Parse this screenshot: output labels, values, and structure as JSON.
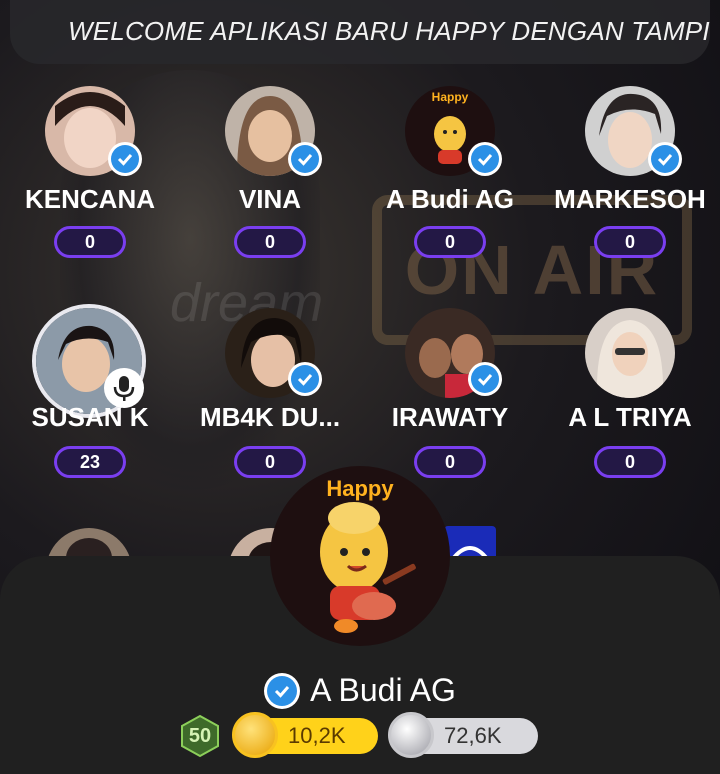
{
  "banner": {
    "text": "WELCOME APLIKASI BARU HAPPY DENGAN TAMPILAN BARU"
  },
  "background": {
    "onair_text": "ON AIR",
    "watermark": "dream"
  },
  "seats_row1": [
    {
      "name": "KENCANA",
      "count": "0",
      "verified": true
    },
    {
      "name": "VINA",
      "count": "0",
      "verified": true
    },
    {
      "name": "A Budi AG",
      "count": "0",
      "verified": true,
      "avatar_text": "Happy"
    },
    {
      "name": "MARKESOH",
      "count": "0",
      "verified": true
    }
  ],
  "seats_row2": [
    {
      "name": "SUSAN K",
      "count": "23",
      "speaking": true
    },
    {
      "name": "MB4K DU...",
      "count": "0",
      "verified": true
    },
    {
      "name": "IRAWATY",
      "count": "0",
      "verified": true
    },
    {
      "name": "A L TRIYA",
      "count": "0"
    }
  ],
  "profile": {
    "avatar_text": "Happy",
    "name": "A Budi AG",
    "level": "50",
    "coins": "10,2K",
    "silver": "72,6K"
  },
  "colors": {
    "accent": "#7a3ef0",
    "verified": "#2b90e6",
    "gold": "#ffd21a",
    "sheet": "#202020"
  }
}
